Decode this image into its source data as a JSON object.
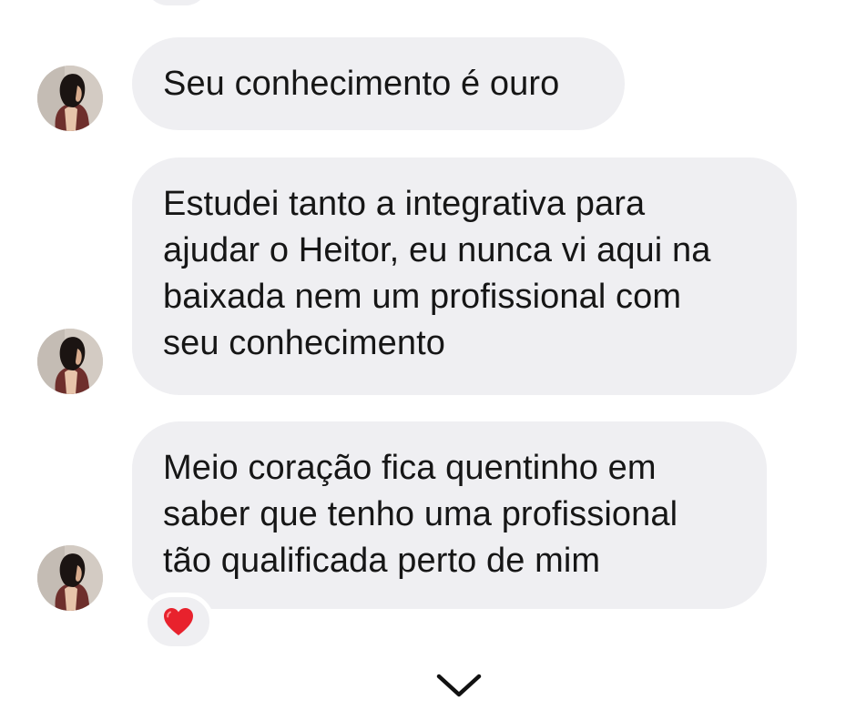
{
  "messages": [
    {
      "text": "Seu conhecimento é ouro"
    },
    {
      "text": "Estudei tanto a integrativa para\najudar o Heitor, eu nunca vi aqui na\nbaixada nem um profissional com\nseu conhecimento"
    },
    {
      "text": "Meio coração fica quentinho em\nsaber que tenho uma profissional\ntão qualificada perto de mim"
    }
  ],
  "reaction": {
    "emoji": "heart-icon",
    "color": "#e8222d"
  },
  "colors": {
    "bubble": "#efeff2",
    "text": "#161616",
    "background": "#ffffff"
  }
}
